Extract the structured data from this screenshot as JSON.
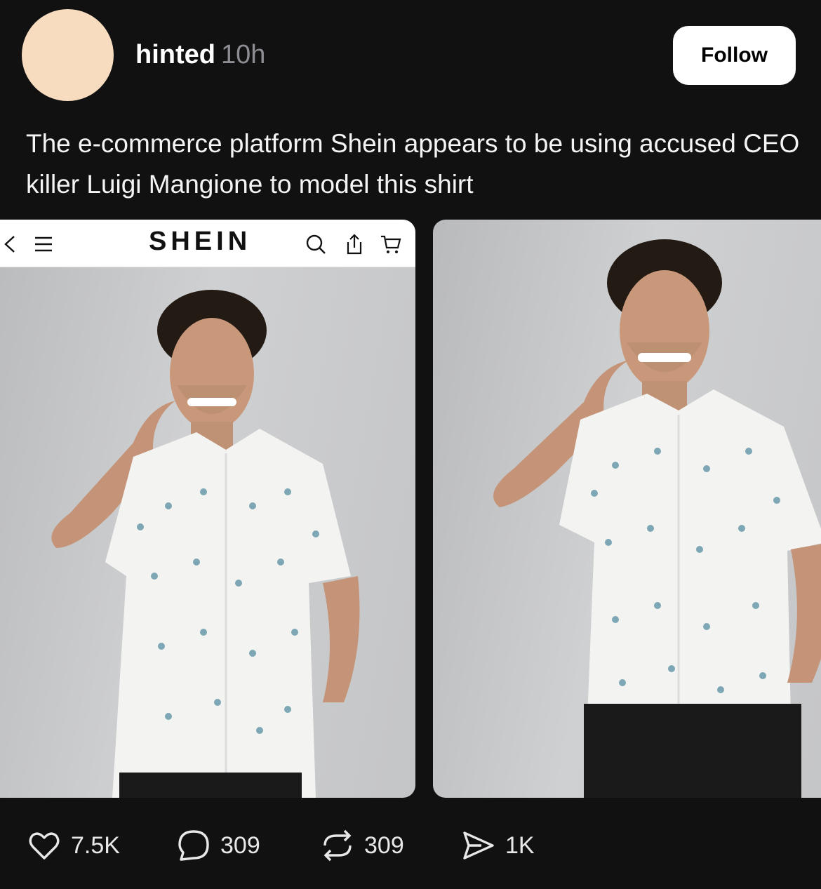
{
  "post": {
    "username": "hinted",
    "time": "10h",
    "follow_label": "Follow",
    "caption": "The e-commerce platform Shein appears to be using accused CEO killer Luigi Mangione to model this shirt"
  },
  "screenshot": {
    "brand": "SHEIN"
  },
  "actions": {
    "likes": "7.5K",
    "replies": "309",
    "reposts": "309",
    "shares": "1K"
  },
  "colors": {
    "background": "#111112",
    "avatar": "#f7dcc0",
    "follow_bg": "#ffffff",
    "muted_text": "#8d8d93"
  }
}
